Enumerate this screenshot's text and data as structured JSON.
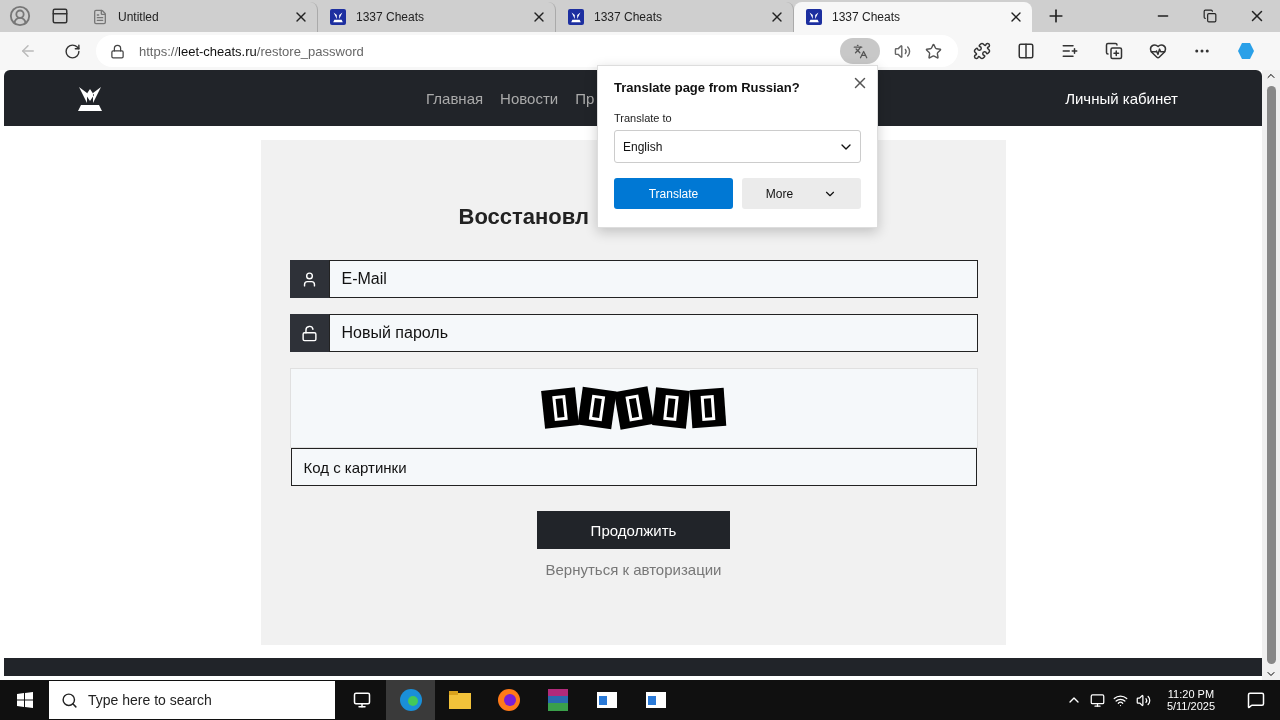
{
  "browser": {
    "tabs": [
      {
        "title": "Untitled",
        "kind": "blank",
        "selected": false
      },
      {
        "title": "1337 Cheats",
        "kind": "site",
        "selected": false
      },
      {
        "title": "1337 Cheats",
        "kind": "site",
        "selected": false
      },
      {
        "title": "1337 Cheats",
        "kind": "site",
        "selected": true
      }
    ],
    "url": {
      "scheme": "https://",
      "host": "leet-cheats.ru",
      "path": "/restore_password"
    }
  },
  "site": {
    "nav": [
      "Главная",
      "Новости",
      "Пр"
    ],
    "account_link": "Личный кабинет"
  },
  "form": {
    "heading": "Восстановл",
    "fields": [
      {
        "kind": "email",
        "placeholder": "E-Mail"
      },
      {
        "kind": "password",
        "placeholder": "Новый пароль"
      }
    ],
    "captcha": {
      "kind": "picture",
      "placeholder": "Код с картинки"
    },
    "submit": "Продолжить",
    "back_link": "Вернуться к авторизации"
  },
  "translate_popup": {
    "title": "Translate page from Russian?",
    "label": "Translate to",
    "language": "English",
    "primary": "Translate",
    "secondary": "More"
  },
  "taskbar": {
    "search_placeholder": "Type here to search",
    "time": "11:20 PM",
    "date": "5/11/2025"
  }
}
